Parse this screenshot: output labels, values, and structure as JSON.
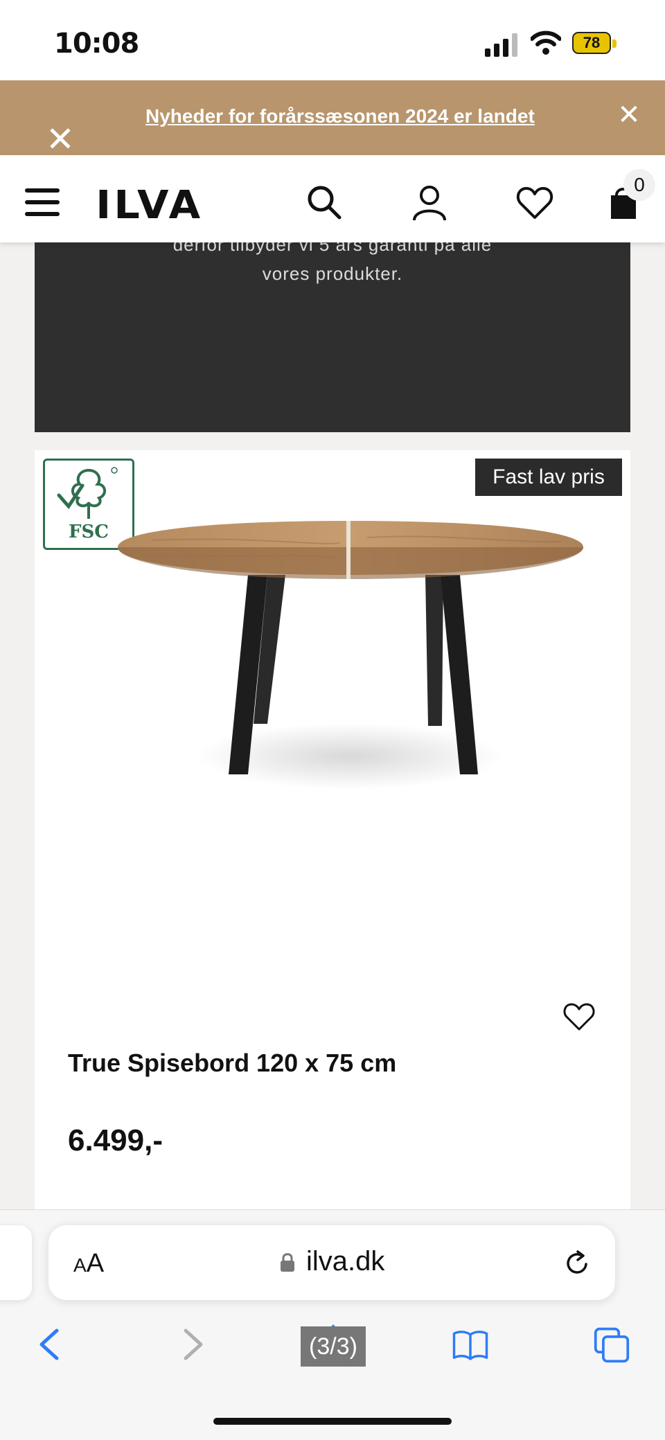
{
  "status_bar": {
    "time": "10:08",
    "battery": "78"
  },
  "promo": {
    "text": "Nyheder for forårssæsonen 2024 er landet"
  },
  "header": {
    "logo": "ILVA",
    "cart_count": "0"
  },
  "guarantee": {
    "line1": "derfor tilbyder vi 5 års garanti på alle",
    "line2": "vores produkter."
  },
  "product": {
    "badge": "Fast lav pris",
    "fsc_label": "FSC",
    "name": "True Spisebord 120 x 75 cm",
    "price": "6.499,-"
  },
  "browser": {
    "aa_large": "A",
    "aa_small": "A",
    "url": "ilva.dk",
    "page_counter": "(3/3)"
  },
  "colors": {
    "promo_bg": "#b8956c",
    "dark_card": "#2f2f2f",
    "fsc_green": "#2f6f4e",
    "ios_blue": "#2f7cf6"
  }
}
